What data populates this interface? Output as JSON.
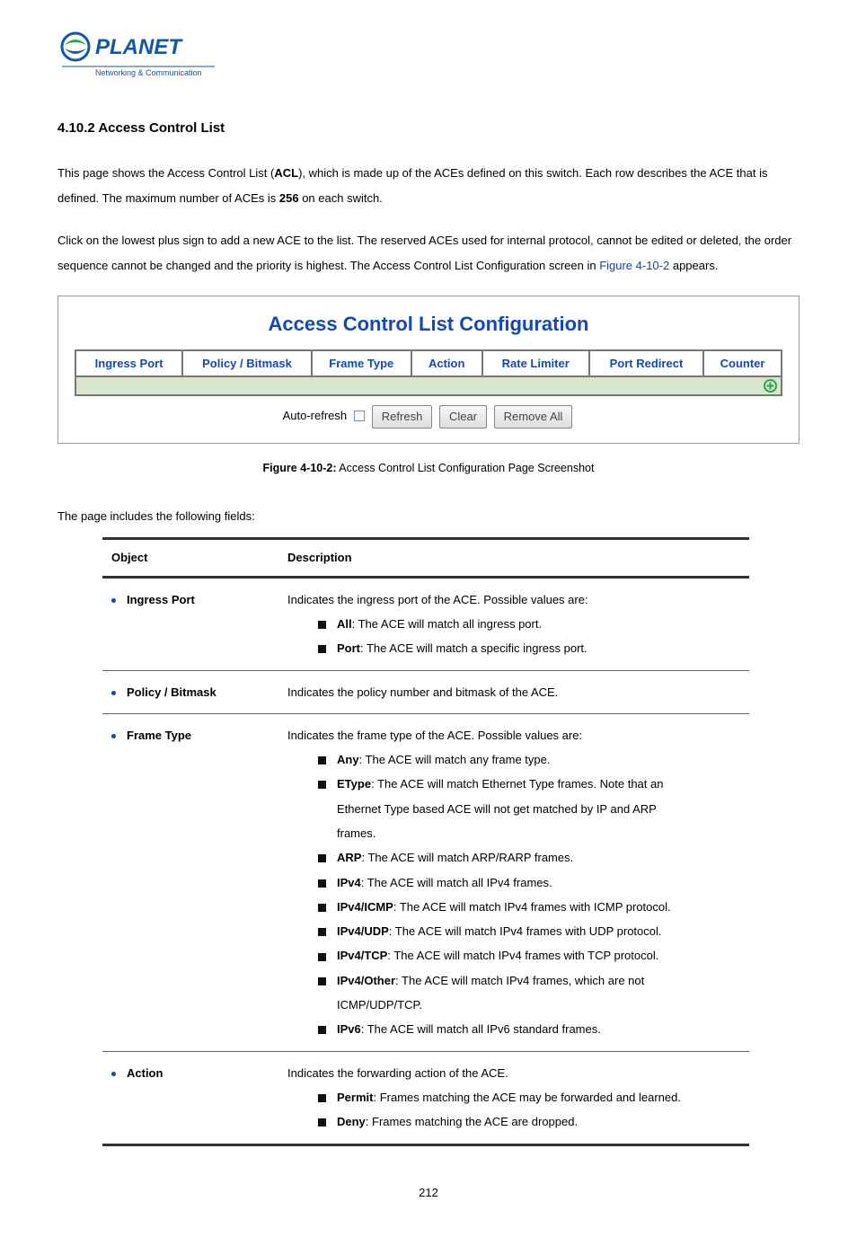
{
  "logo": {
    "main": "PLANET",
    "sub": "Networking & Communication"
  },
  "section_title": "4.10.2 Access Control List",
  "para1a": "This page shows the Access Control List (",
  "para1b": "ACL",
  "para1c": "), which is made up of the ACEs defined on this switch. Each row describes the ACE that is defined. The maximum number of ACEs is ",
  "para1d": "256",
  "para1e": " on each switch.",
  "para2a": "Click on the lowest plus sign to add a new ACE to the list. The reserved ACEs used for internal protocol, cannot be edited or deleted, the order sequence cannot be changed and the priority is highest. The Access Control List Configuration screen in ",
  "para2_link": "Figure 4-10-2",
  "para2b": " appears.",
  "panel": {
    "title": "Access Control List Configuration",
    "headers": [
      "Ingress Port",
      "Policy / Bitmask",
      "Frame Type",
      "Action",
      "Rate Limiter",
      "Port Redirect",
      "Counter"
    ],
    "auto_refresh": "Auto-refresh",
    "btn_refresh": "Refresh",
    "btn_clear": "Clear",
    "btn_remove": "Remove All"
  },
  "caption_a": "Figure 4-10-2:",
  "caption_b": " Access Control List Configuration Page Screenshot",
  "intro2": "The page includes the following fields:",
  "table_head": {
    "obj": "Object",
    "desc": "Description"
  },
  "rows": {
    "ingress": {
      "name": "Ingress Port",
      "desc": "Indicates the ingress port of the ACE. Possible values are:",
      "v1n": "All",
      "v1d": ": The ACE will match all ingress port.",
      "v2n": "Port",
      "v2d": ": The ACE will match a specific ingress port."
    },
    "policy": {
      "name": "Policy / Bitmask",
      "desc": "Indicates the policy number and bitmask of the ACE."
    },
    "frame": {
      "name": "Frame Type",
      "desc": "Indicates the frame type of the ACE. Possible values are:",
      "v1n": "Any",
      "v1d": ": The ACE will match any frame type.",
      "v2n": "EType",
      "v2d": ": The ACE will match Ethernet Type frames. Note that an",
      "v2c": "Ethernet Type based ACE will not get matched by IP and ARP",
      "v2c2": "frames.",
      "v3n": "ARP",
      "v3d": ": The ACE will match ARP/RARP frames.",
      "v4n": "IPv4",
      "v4d": ": The ACE will match all IPv4 frames.",
      "v5n": "IPv4/ICMP",
      "v5d": ": The ACE will match IPv4 frames with ICMP protocol.",
      "v6n": "IPv4/UDP",
      "v6d": ": The ACE will match IPv4 frames with UDP protocol.",
      "v7n": "IPv4/TCP",
      "v7d": ": The ACE will match IPv4 frames with TCP protocol.",
      "v8n": "IPv4/Other",
      "v8d": ": The ACE will match IPv4 frames, which are not",
      "v8c": "ICMP/UDP/TCP.",
      "v9n": "IPv6",
      "v9d": ": The ACE will match all IPv6 standard frames."
    },
    "action": {
      "name": "Action",
      "desc": "Indicates the forwarding action of the ACE.",
      "v1n": "Permit",
      "v1d": ": Frames matching the ACE may be forwarded and learned.",
      "v2n": "Deny",
      "v2d": ": Frames matching the ACE are dropped."
    }
  },
  "pagenum": "212"
}
